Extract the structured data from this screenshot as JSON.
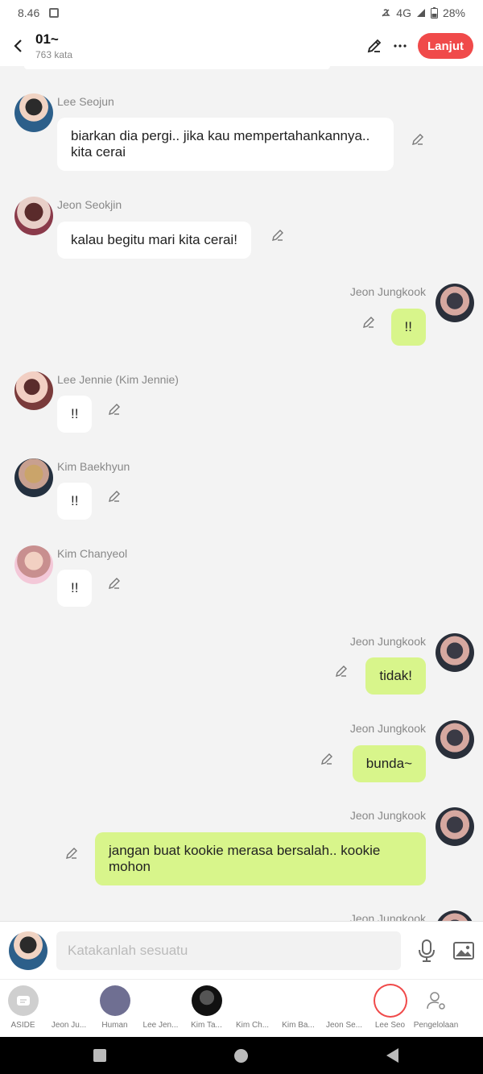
{
  "status": {
    "time": "8.46",
    "network": "4G",
    "battery": "28%"
  },
  "header": {
    "title": "01~",
    "subtitle": "763 kata",
    "next_label": "Lanjut"
  },
  "messages": [
    {
      "name": "Lee Seojun",
      "text": "biarkan dia pergi.. jika kau mempertahankannya.. kita cerai"
    },
    {
      "name": "Jeon Seokjin",
      "text": "kalau begitu mari kita cerai!"
    },
    {
      "name": "Jeon Jungkook",
      "text": "!!"
    },
    {
      "name": "Lee Jennie (Kim Jennie)",
      "text": "!!"
    },
    {
      "name": "Kim Baekhyun",
      "text": "!!"
    },
    {
      "name": "Kim Chanyeol",
      "text": "!!"
    },
    {
      "name": "Jeon Jungkook",
      "text": "tidak!"
    },
    {
      "name": "Jeon Jungkook",
      "text": "bunda~"
    },
    {
      "name": "Jeon Jungkook",
      "text": "jangan buat kookie merasa bersalah.. kookie mohon"
    },
    {
      "name": "Jeon Jungkook"
    }
  ],
  "input": {
    "placeholder": "Katakanlah sesuatu"
  },
  "characters": [
    {
      "label": "ASIDE"
    },
    {
      "label": "Jeon Ju..."
    },
    {
      "label": "Human"
    },
    {
      "label": "Lee Jen..."
    },
    {
      "label": "Kim Ta..."
    },
    {
      "label": "Kim Ch..."
    },
    {
      "label": "Kim Ba..."
    },
    {
      "label": "Jeon Se..."
    },
    {
      "label": "Lee Seo"
    },
    {
      "label": "Pengelolaan"
    }
  ]
}
